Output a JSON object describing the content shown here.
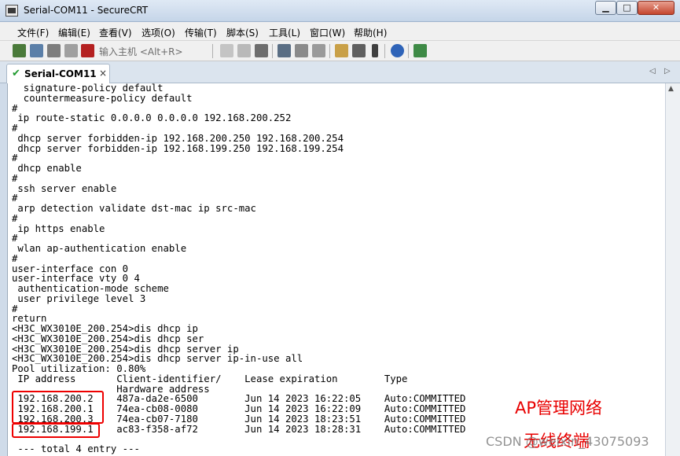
{
  "window": {
    "title": "Serial-COM11 - SecureCRT"
  },
  "menu": [
    "文件(F)",
    "编辑(E)",
    "查看(V)",
    "选项(O)",
    "传输(T)",
    "脚本(S)",
    "工具(L)",
    "窗口(W)",
    "帮助(H)"
  ],
  "toolbar": {
    "host_hint": "输入主机 <Alt+R>"
  },
  "tab": {
    "label": "Serial-COM11",
    "close": "×"
  },
  "terminal": {
    "lines": [
      "  signature-policy default",
      "  countermeasure-policy default",
      "#",
      " ip route-static 0.0.0.0 0.0.0.0 192.168.200.252",
      "#",
      " dhcp server forbidden-ip 192.168.200.250 192.168.200.254",
      " dhcp server forbidden-ip 192.168.199.250 192.168.199.254",
      "#",
      " dhcp enable",
      "#",
      " ssh server enable",
      "#",
      " arp detection validate dst-mac ip src-mac",
      "#",
      " ip https enable",
      "#",
      " wlan ap-authentication enable",
      "#",
      "user-interface con 0",
      "user-interface vty 0 4",
      " authentication-mode scheme",
      " user privilege level 3",
      "#",
      "return",
      "<H3C_WX3010E_200.254>dis dhcp ip",
      "<H3C_WX3010E_200.254>dis dhcp ser",
      "<H3C_WX3010E_200.254>dis dhcp server ip",
      "<H3C_WX3010E_200.254>dis dhcp server ip-in-use all",
      "Pool utilization: 0.80%",
      " IP address       Client-identifier/    Lease expiration        Type",
      "                  Hardware address",
      " 192.168.200.2    487a-da2e-6500        Jun 14 2023 16:22:05    Auto:COMMITTED",
      " 192.168.200.1    74ea-cb08-0080        Jun 14 2023 16:22:09    Auto:COMMITTED",
      " 192.168.200.3    74ea-cb07-7180        Jun 14 2023 18:23:51    Auto:COMMITTED",
      " 192.168.199.1    ac83-f358-af72        Jun 14 2023 18:28:31    Auto:COMMITTED",
      "",
      " --- total 4 entry ---"
    ]
  },
  "annotations": {
    "ap_label": "AP管理网络",
    "wireless_label": "无线终端"
  },
  "watermark": "CSDN @weixin_43075093",
  "colors": {
    "annotation": "#e00000"
  }
}
